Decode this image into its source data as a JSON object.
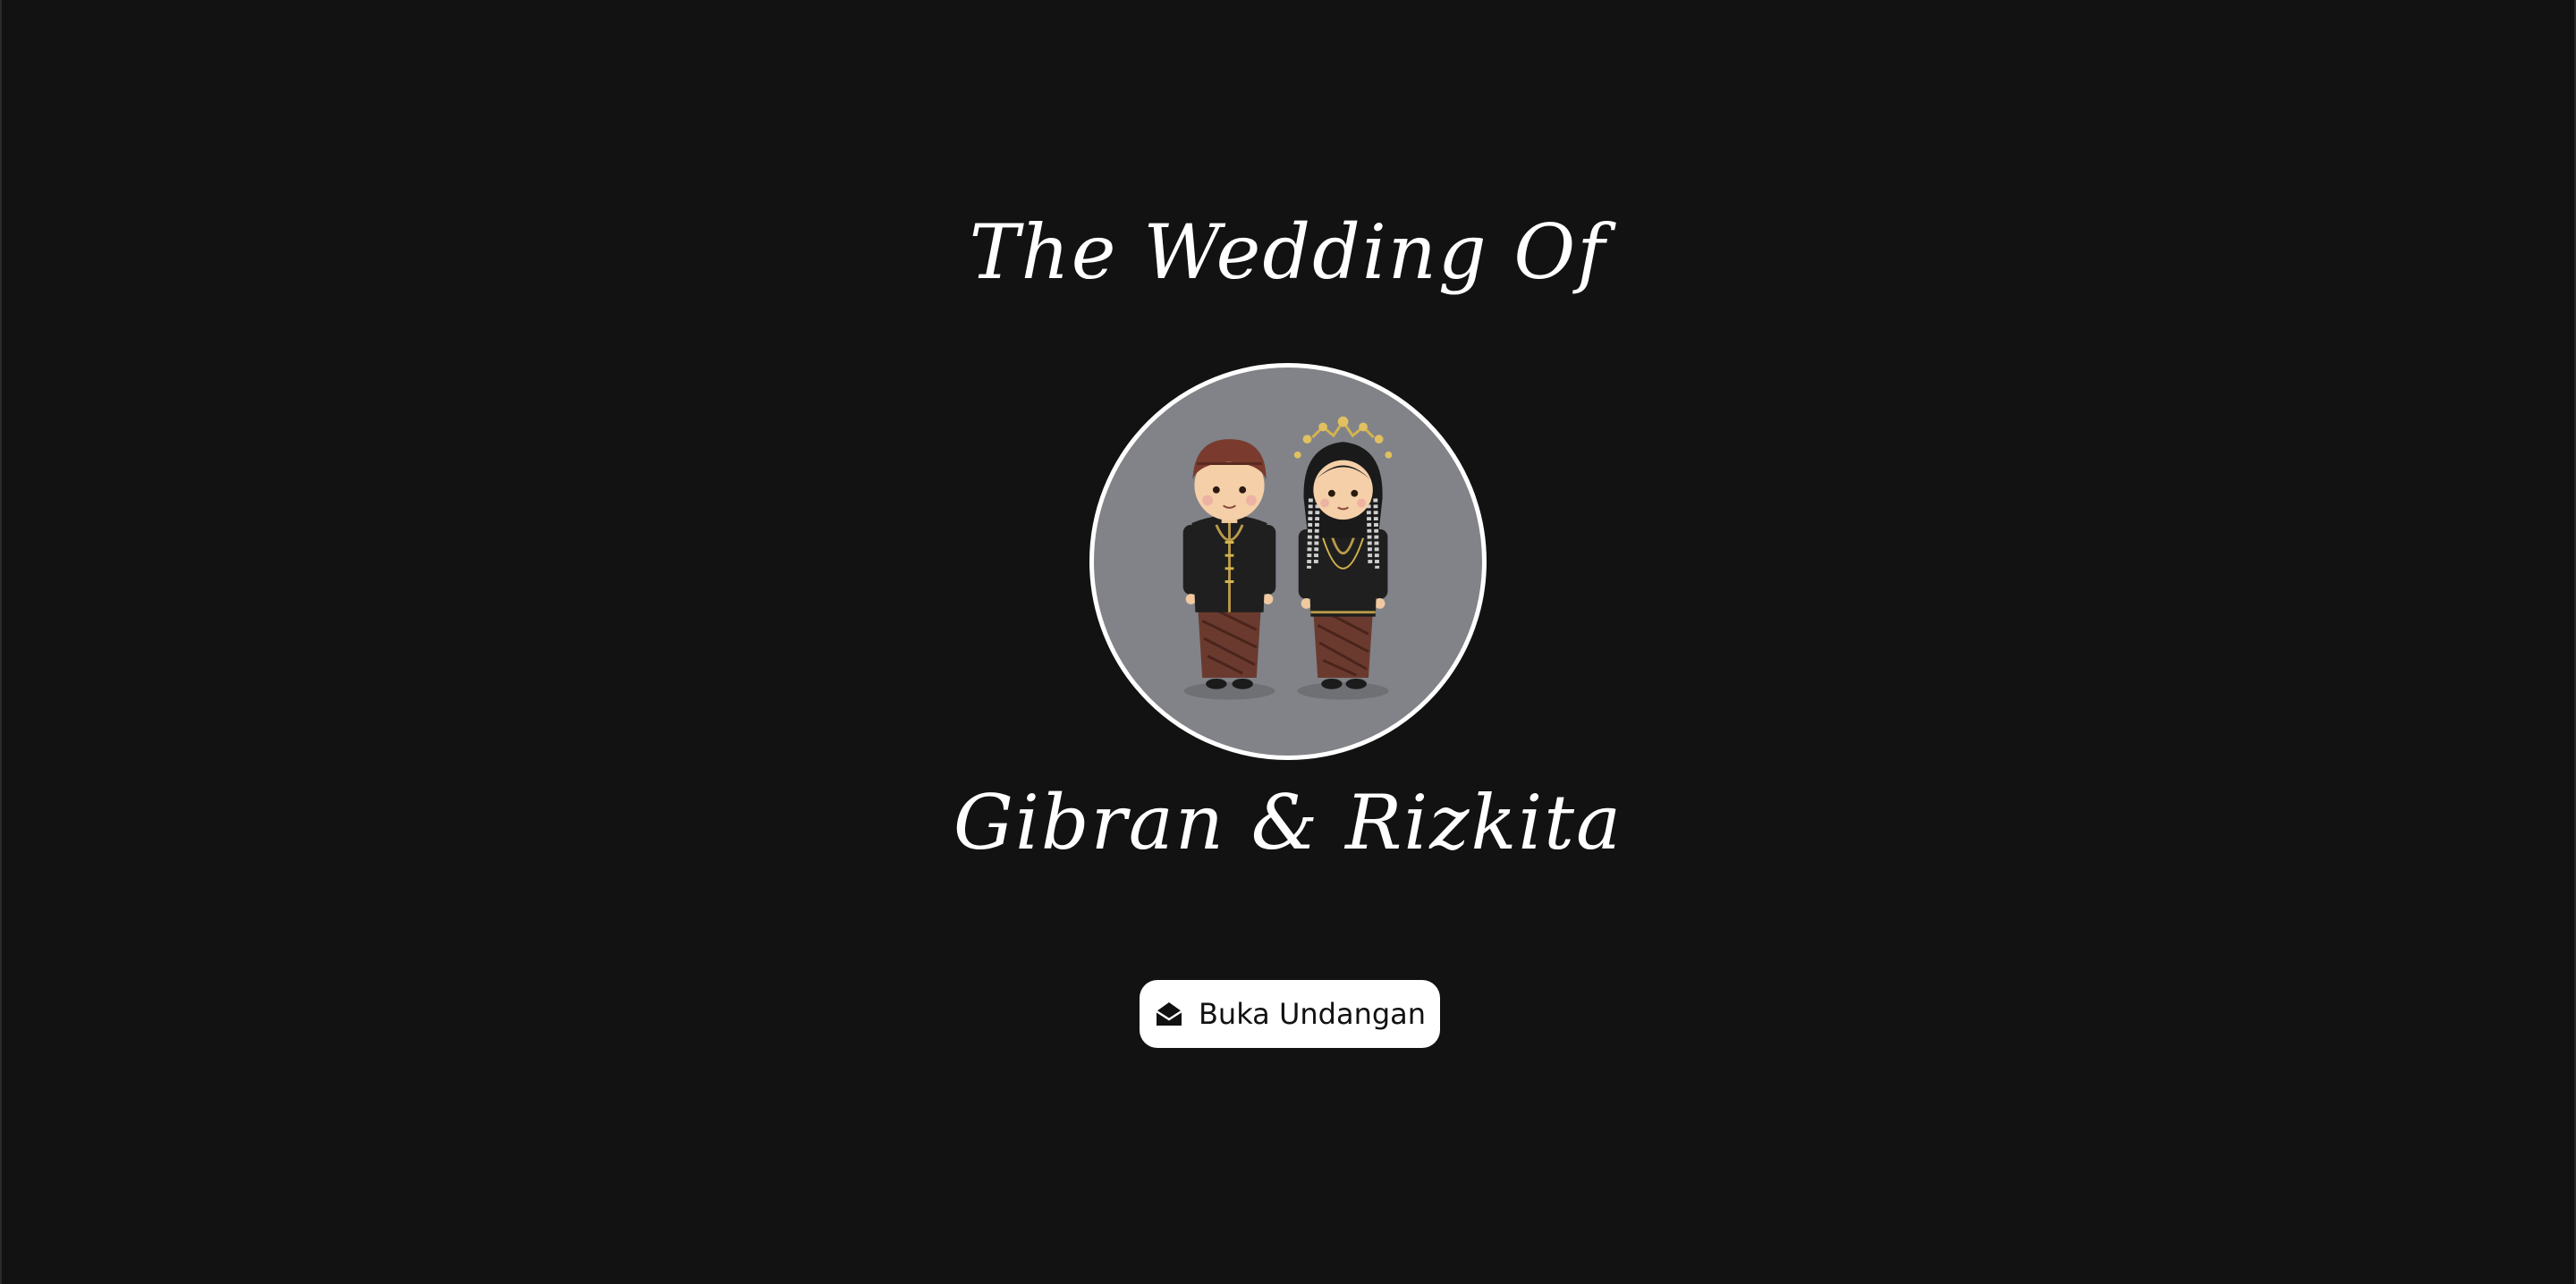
{
  "cover": {
    "title": "The Wedding Of",
    "couple_names": "Gibran & Rizkita",
    "open_button_label": "Buka Undangan",
    "open_button_icon": "envelope-open-icon",
    "portrait_icon": "couple-illustration"
  },
  "colors": {
    "background": "#121212",
    "text": "#ffffff",
    "portrait_bg": "#818388",
    "button_bg": "#ffffff",
    "button_text": "#111111"
  }
}
